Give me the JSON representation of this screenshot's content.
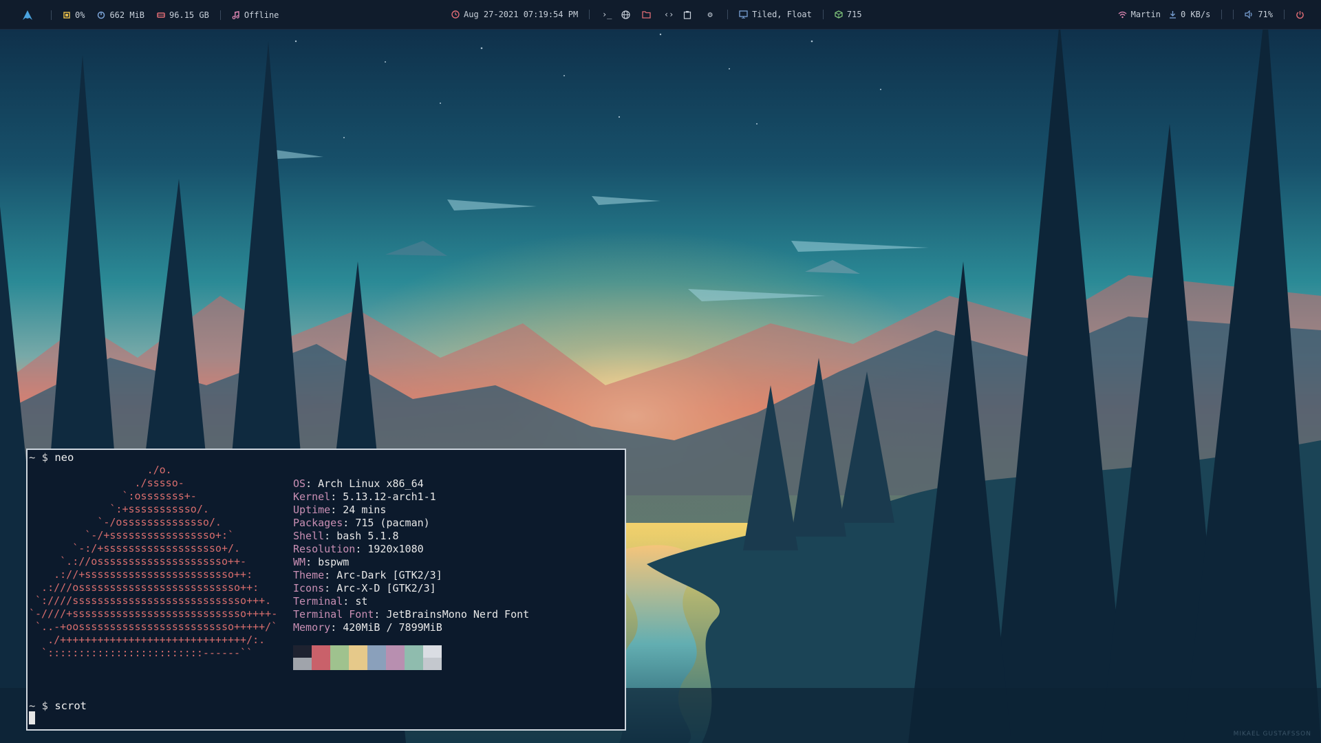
{
  "topbar": {
    "cpu": "0%",
    "memory": "662 MiB",
    "disk": "96.15 GB",
    "music": "Offline",
    "datetime": "Aug 27-2021 07:19:54 PM",
    "workspaces": [
      {
        "icon": "terminal-icon",
        "glyph": "›_"
      },
      {
        "icon": "globe-icon",
        "glyph": "⊕"
      },
      {
        "icon": "folder-icon",
        "glyph": "▭"
      },
      {
        "icon": "code-icon",
        "glyph": "‹›"
      },
      {
        "icon": "clipboard-icon",
        "glyph": "▢"
      },
      {
        "icon": "gear-icon",
        "glyph": "⚙"
      }
    ],
    "layout": "Tiled, Float",
    "updates": "715",
    "network_name": "Martin",
    "download_speed": "0 KB/s",
    "volume": "71%"
  },
  "colors": {
    "bar_bg": "#101c2c",
    "ascii": "#d76d6d",
    "info_key": "#c98fb4",
    "icon_yellow": "#e0b84a",
    "icon_blue": "#7aa2d6",
    "icon_red": "#e06c75",
    "icon_green": "#7ec27a",
    "icon_pink": "#e38ab7"
  },
  "terminal": {
    "prompt_symbol": "~ $",
    "command1": "neo",
    "command2": "scrot",
    "ascii_art": [
      "                   ./o.",
      "                 ./sssso-",
      "               `:osssssss+-",
      "             `:+sssssssssso/.",
      "           `-/ossssssssssssso/.",
      "         `-/+sssssssssssssssso+:`",
      "       `-:/+sssssssssssssssssso+/.",
      "     `.://osssssssssssssssssssso++-",
      "    .://+ssssssssssssssssssssssso++:",
      "  .:///ossssssssssssssssssssssssso++:",
      " `:////ssssssssssssssssssssssssssso+++.",
      "`-////+ssssssssssssssssssssssssssso++++-",
      " `..-+oosssssssssssssssssssssssso+++++/`",
      "   ./++++++++++++++++++++++++++++++/:.",
      "  `:::::::::::::::::::::::::------``"
    ],
    "info": [
      {
        "key": "OS",
        "value": "Arch Linux x86_64"
      },
      {
        "key": "Kernel",
        "value": "5.13.12-arch1-1"
      },
      {
        "key": "Uptime",
        "value": "24 mins"
      },
      {
        "key": "Packages",
        "value": "715 (pacman)"
      },
      {
        "key": "Shell",
        "value": "bash 5.1.8"
      },
      {
        "key": "Resolution",
        "value": "1920x1080"
      },
      {
        "key": "WM",
        "value": "bspwm"
      },
      {
        "key": "Theme",
        "value": "Arc-Dark [GTK2/3]"
      },
      {
        "key": "Icons",
        "value": "Arc-X-D [GTK2/3]"
      },
      {
        "key": "Terminal",
        "value": "st"
      },
      {
        "key": "Terminal Font",
        "value": "JetBrainsMono Nerd Font"
      },
      {
        "key": "Memory",
        "value": "420MiB / 7899MiB"
      }
    ],
    "palette_top": [
      "#1e2230",
      "#c9616a",
      "#9fc28e",
      "#e6c98a",
      "#8aa0bb",
      "#b88fb0",
      "#8fbcae",
      "#dadde3"
    ],
    "palette_bottom": [
      "#a0a4ab",
      "#c9616a",
      "#9fc28e",
      "#e6c98a",
      "#8aa0bb",
      "#b88fb0",
      "#8fbcae",
      "#c4c8ce"
    ]
  },
  "wallpaper": {
    "credit": "MIKAEL GUSTAFSSON"
  }
}
